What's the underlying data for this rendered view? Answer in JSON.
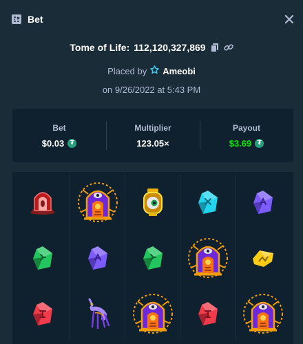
{
  "header": {
    "title": "Bet",
    "icon": "bet-slip-icon",
    "close_icon": "close-icon"
  },
  "game": {
    "name": "Tome of Life:",
    "bet_id": "112,120,327,869",
    "copy_icon": "copy-icon",
    "link_icon": "link-icon"
  },
  "placed": {
    "prefix": "Placed by",
    "user_icon": "star-badge-icon",
    "username": "Ameobi"
  },
  "date": {
    "text": "on 9/26/2022 at 5:43 PM"
  },
  "stats": {
    "bet": {
      "label": "Bet",
      "value": "$0.03",
      "currency_icon": "tether-coin-icon"
    },
    "multiplier": {
      "label": "Multiplier",
      "value": "123.05×"
    },
    "payout": {
      "label": "Payout",
      "value": "$3.69",
      "currency_icon": "tether-coin-icon"
    }
  },
  "colors": {
    "background": "#1a2c38",
    "panel": "#0f212e",
    "muted_text": "#b1bad3",
    "payout_green": "#00e701"
  },
  "reels": [
    [
      "red-portal",
      "tome-wild",
      "eye-lantern",
      "cyan-gem",
      "purple-gem"
    ],
    [
      "green-gem",
      "purple-gem",
      "green-gem",
      "tome-wild",
      "yellow-gem"
    ],
    [
      "red-gem",
      "jackal-creature",
      "tome-wild",
      "red-gem",
      "tome-wild"
    ]
  ]
}
